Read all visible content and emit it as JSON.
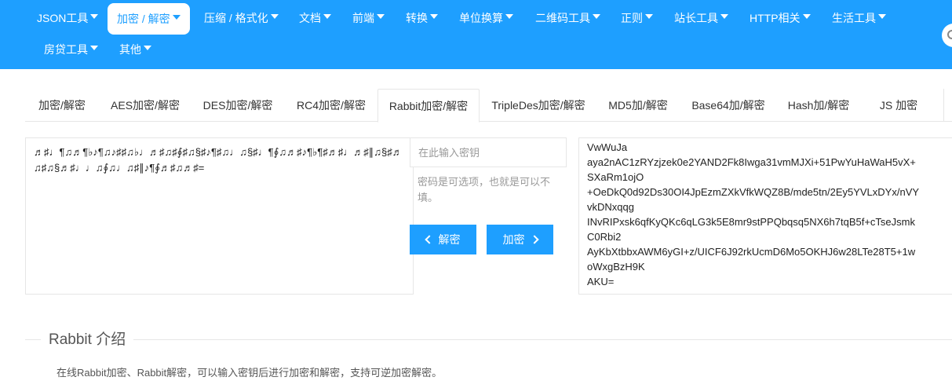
{
  "nav": {
    "row1": [
      {
        "label": "JSON工具"
      },
      {
        "label": "加密 / 解密"
      },
      {
        "label": "压缩 / 格式化"
      },
      {
        "label": "文档"
      },
      {
        "label": "前端"
      },
      {
        "label": "转换"
      },
      {
        "label": "单位换算"
      },
      {
        "label": "二维码工具"
      },
      {
        "label": "正则"
      },
      {
        "label": "站长工具"
      },
      {
        "label": "HTTP相关"
      },
      {
        "label": "生活工具"
      }
    ],
    "row2": [
      {
        "label": "房贷工具"
      },
      {
        "label": "其他"
      }
    ],
    "active": "加密 / 解密"
  },
  "tabs": [
    {
      "label": "加密/解密"
    },
    {
      "label": "AES加密/解密"
    },
    {
      "label": "DES加密/解密"
    },
    {
      "label": "RC4加密/解密"
    },
    {
      "label": "Rabbit加密/解密"
    },
    {
      "label": "TripleDes加密/解密"
    },
    {
      "label": "MD5加/解密"
    },
    {
      "label": "Base64加/解密"
    },
    {
      "label": "Hash加/解密"
    },
    {
      "label": "JS 加密"
    }
  ],
  "active_tab": "Rabbit加密/解密",
  "source_text": "♬♯♩¶♫♬¶♭♪¶♫♪♯♯♫♭♩♬♯♫♯∮♯♫§♯♪¶♯♫♩♫§♯♩¶∮♫♬♯♪¶♭¶♯♬♯♩♬♯∥♫§♯♬♫♯♫§♬♯♩♩♫∮♫♩♫♯∥♪¶∮♬♯♫♬♯=",
  "key": {
    "placeholder": "在此输入密钥",
    "value": "",
    "hint": "密码是可选项，也就是可以不填。"
  },
  "buttons": {
    "decrypt": "解密",
    "encrypt": "加密"
  },
  "output_lines": [
    "VwWuJa",
    "aya2nAC1zRYzjzek0e2YAND2Fk8Iwga31vmMJXi+51PwYuHaWaH5vX+",
    "SXaRm1ojO",
    "+OeDkQ0d92Ds30OI4JpEzmZXkVfkWQZ8B/mde5tn/2Ey5YVLxDYx/nVY",
    "vkDNxqqg",
    "INvRIPxsk6qfKyQKc6qLG3k5E8mr9stPPQbqsq5NX6h7tqB5f+cTseJsmk",
    "C0Rbi2",
    "AyKbXtbbxAWM6yGI+z/UICF6J92rkUcmD6Mo5OKHJ6w28LTe28T5+1w",
    "oWxgBzH9K",
    "AKU="
  ],
  "intro": {
    "title": "Rabbit 介绍",
    "text": "在线Rabbit加密、Rabbit解密，可以输入密钥后进行加密和解密，支持可逆加密解密。"
  },
  "colors": {
    "accent": "#1E9FFF",
    "border": "#e6e6e6"
  }
}
